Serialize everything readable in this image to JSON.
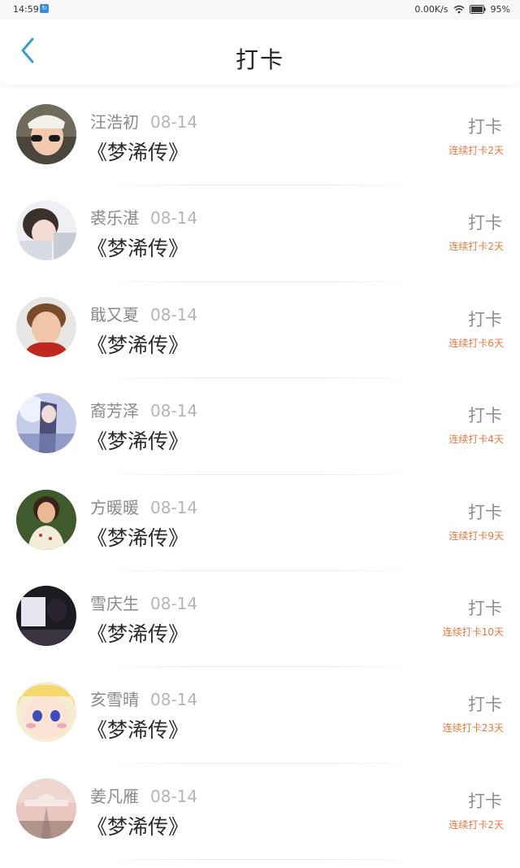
{
  "status_bar": {
    "time": "14:59",
    "notification_glyph": "↻",
    "net_speed": "0.00K/s",
    "battery": "95%"
  },
  "header": {
    "title": "打卡",
    "back_icon": "chevron-left-icon",
    "accent_color": "#3b9bd8"
  },
  "rows": [
    {
      "name": "汪浩初",
      "date": "08-14",
      "book": "《梦浠传》",
      "action": "打卡",
      "streak": "连续打卡2天"
    },
    {
      "name": "裘乐湛",
      "date": "08-14",
      "book": "《梦浠传》",
      "action": "打卡",
      "streak": "连续打卡2天"
    },
    {
      "name": "戢又夏",
      "date": "08-14",
      "book": "《梦浠传》",
      "action": "打卡",
      "streak": "连续打卡6天"
    },
    {
      "name": "裔芳泽",
      "date": "08-14",
      "book": "《梦浠传》",
      "action": "打卡",
      "streak": "连续打卡4天"
    },
    {
      "name": "方暖暖",
      "date": "08-14",
      "book": "《梦浠传》",
      "action": "打卡",
      "streak": "连续打卡9天"
    },
    {
      "name": "雪庆生",
      "date": "08-14",
      "book": "《梦浠传》",
      "action": "打卡",
      "streak": "连续打卡10天"
    },
    {
      "name": "亥雪晴",
      "date": "08-14",
      "book": "《梦浠传》",
      "action": "打卡",
      "streak": "连续打卡23天"
    },
    {
      "name": "姜凡雁",
      "date": "08-14",
      "book": "《梦浠传》",
      "action": "打卡",
      "streak": "连续打卡2天"
    }
  ],
  "colors": {
    "streak": "#e8783f",
    "name": "#8a8a8a",
    "book": "#2b2b2b"
  }
}
